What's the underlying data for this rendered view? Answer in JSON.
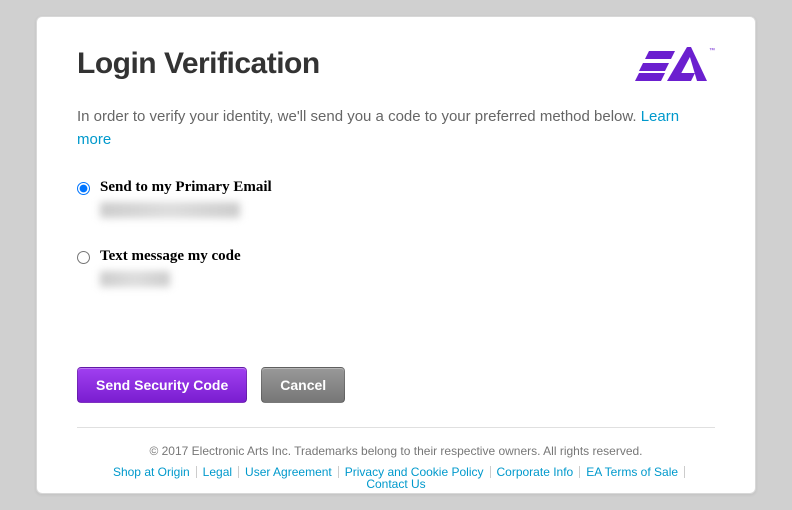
{
  "page": {
    "title": "Login Verification",
    "description": "In order to verify your identity, we'll send you a code to your preferred method below.  ",
    "learn_more": "Learn more"
  },
  "options": {
    "email": {
      "label": "Send to my Primary Email",
      "selected": true
    },
    "sms": {
      "label": "Text message my code",
      "selected": false
    }
  },
  "buttons": {
    "send": "Send Security Code",
    "cancel": "Cancel"
  },
  "footer": {
    "copyright": "© 2017 Electronic Arts Inc. Trademarks belong to their respective owners. All rights reserved.",
    "links": [
      "Shop at Origin",
      "Legal",
      "User Agreement",
      "Privacy and Cookie Policy",
      "Corporate Info",
      "EA Terms of Sale",
      "Contact Us"
    ]
  },
  "brand": {
    "name": "EA",
    "tm": "™"
  }
}
